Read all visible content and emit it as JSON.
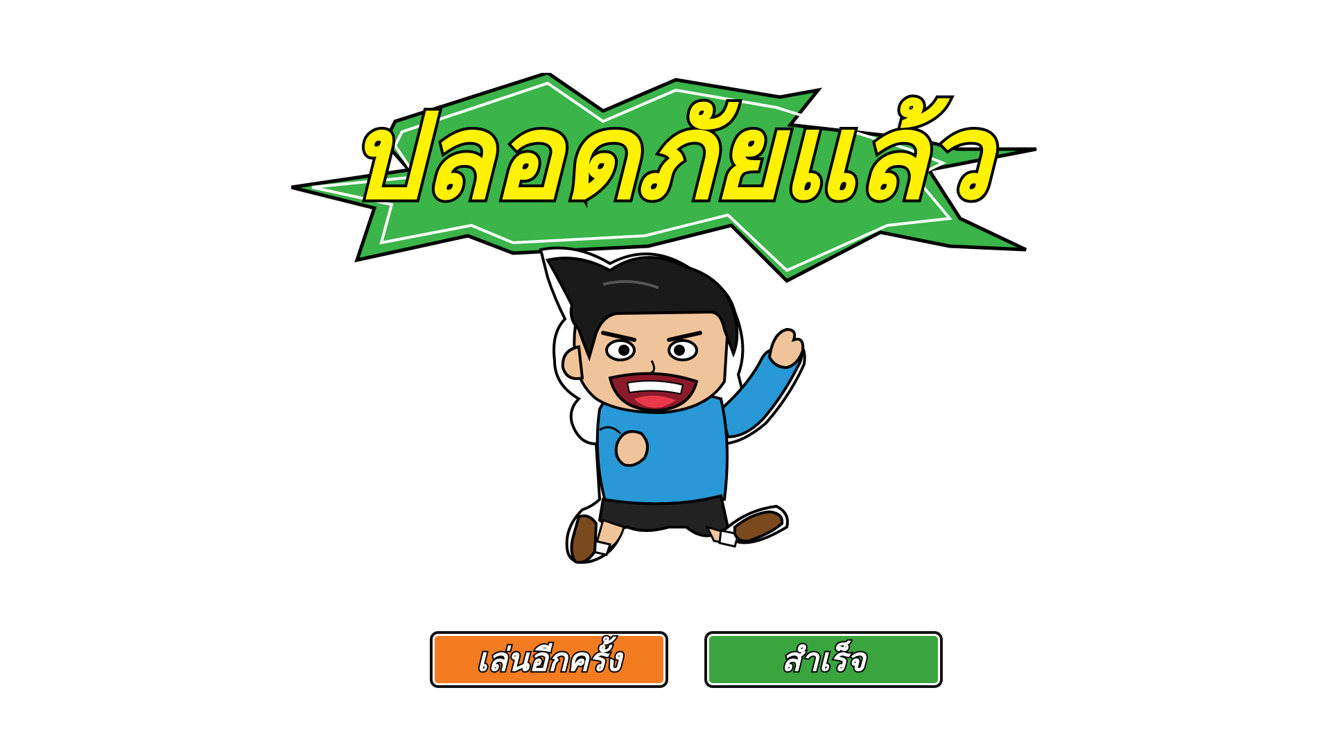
{
  "title": {
    "text": "ปลอดภัยแล้ว",
    "text_color": "#fff200",
    "outline_color": "#000000",
    "burst_color": "#3bb44a"
  },
  "character": {
    "icon": "running-boy-character",
    "shirt_color": "#2899d6",
    "shorts_color": "#222222",
    "hair_color": "#1a1a1a",
    "skin_color": "#f0c49a"
  },
  "buttons": {
    "replay_label": "เล่นอีกครั้ง",
    "replay_color": "#f47c20",
    "done_label": "สำเร็จ",
    "done_color": "#3aa53f"
  }
}
